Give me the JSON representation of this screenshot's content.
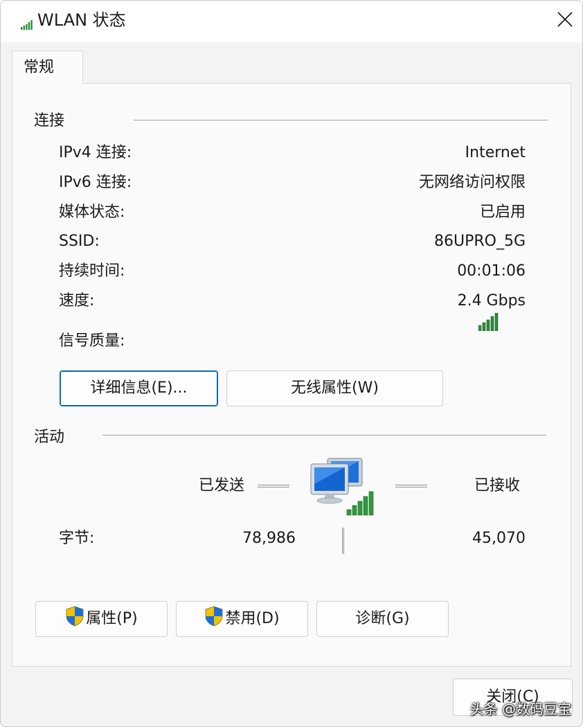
{
  "window": {
    "title": "WLAN 状态",
    "close_icon": "close-icon",
    "signal_icon": "wifi-signal-icon"
  },
  "tabs": [
    {
      "label": "常规",
      "active": true
    }
  ],
  "connection": {
    "group_label": "连接",
    "rows": [
      {
        "label": "IPv4 连接:",
        "value": "Internet"
      },
      {
        "label": "IPv6 连接:",
        "value": "无网络访问权限"
      },
      {
        "label": "媒体状态:",
        "value": "已启用"
      },
      {
        "label": "SSID:",
        "value": "86UPRO_5G"
      },
      {
        "label": "持续时间:",
        "value": "00:01:06"
      },
      {
        "label": "速度:",
        "value": "2.4 Gbps"
      }
    ],
    "signal_label": "信号质量:",
    "signal_bars": 5,
    "signal_bars_total": 5,
    "details_button": "详细信息(E)...",
    "wireless_props_button": "无线属性(W)"
  },
  "activity": {
    "group_label": "活动",
    "sent_label": "已发送",
    "received_label": "已接收",
    "bytes_label": "字节:",
    "bytes_sent": "78,986",
    "bytes_received": "45,070",
    "network_icon": "network-computers-icon"
  },
  "bottom_buttons": {
    "properties": "属性(P)",
    "disable": "禁用(D)",
    "diagnose": "诊断(G)"
  },
  "close_button": "关闭(C)",
  "watermark": "头条 @数码豆宝",
  "colors": {
    "accent": "#0a6ab8",
    "signal_green": "#2e8b3a",
    "window_bg": "#f3f3f3",
    "panel_bg": "#fafafa"
  }
}
